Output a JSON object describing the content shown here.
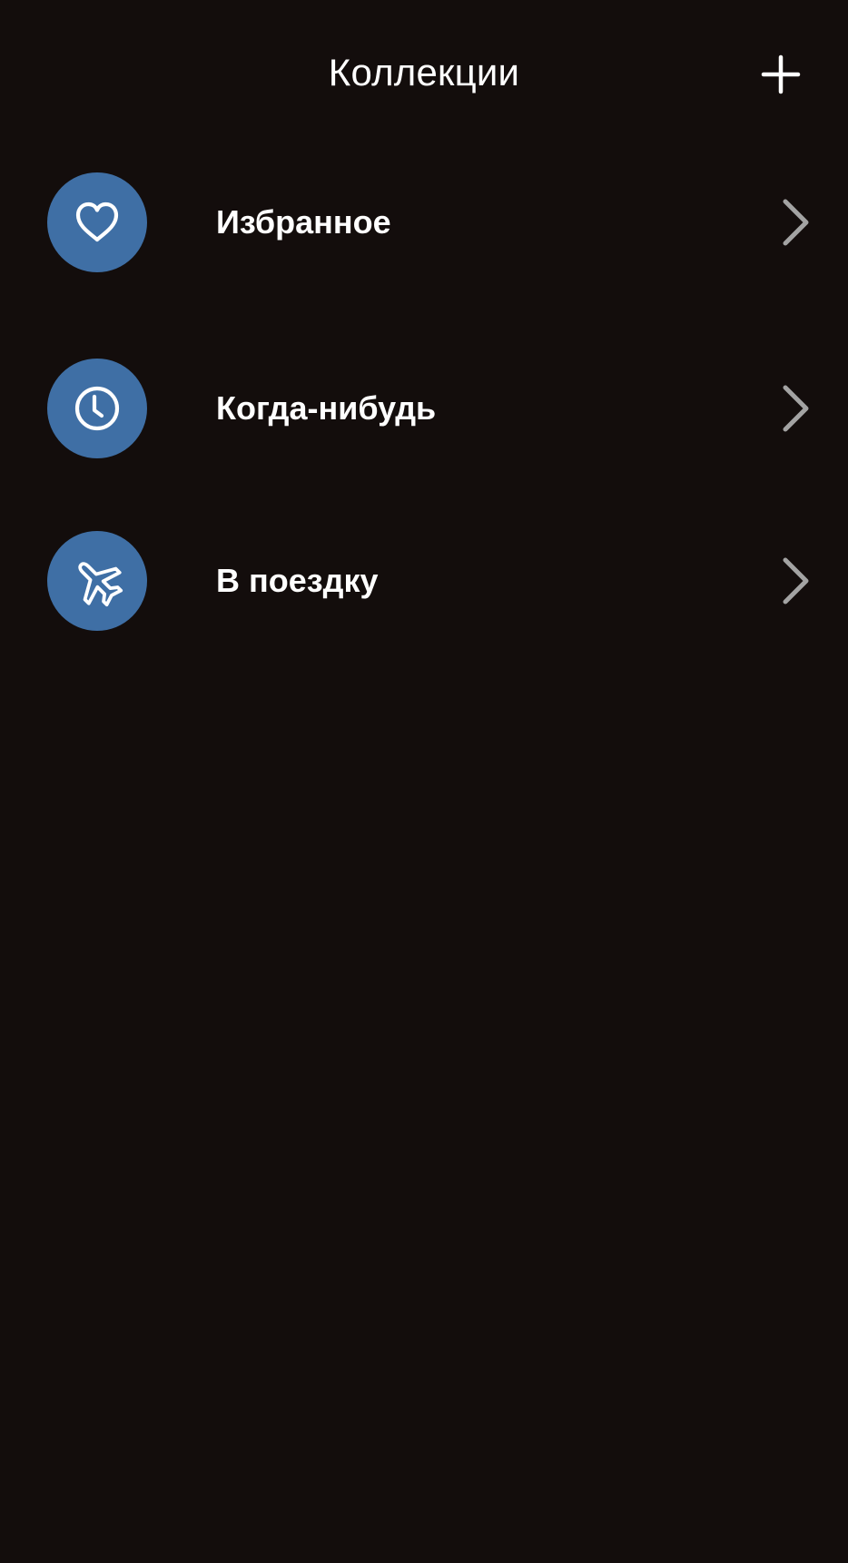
{
  "header": {
    "title": "Коллекции",
    "add_icon": "plus-icon"
  },
  "collections": [
    {
      "label": "Избранное",
      "icon": "heart-icon"
    },
    {
      "label": "Когда-нибудь",
      "icon": "clock-icon"
    },
    {
      "label": "В поездку",
      "icon": "airplane-icon"
    }
  ],
  "colors": {
    "background": "#130d0c",
    "icon_circle": "#3f6fa5",
    "text": "#ffffff",
    "chevron": "#a3a3a3"
  }
}
